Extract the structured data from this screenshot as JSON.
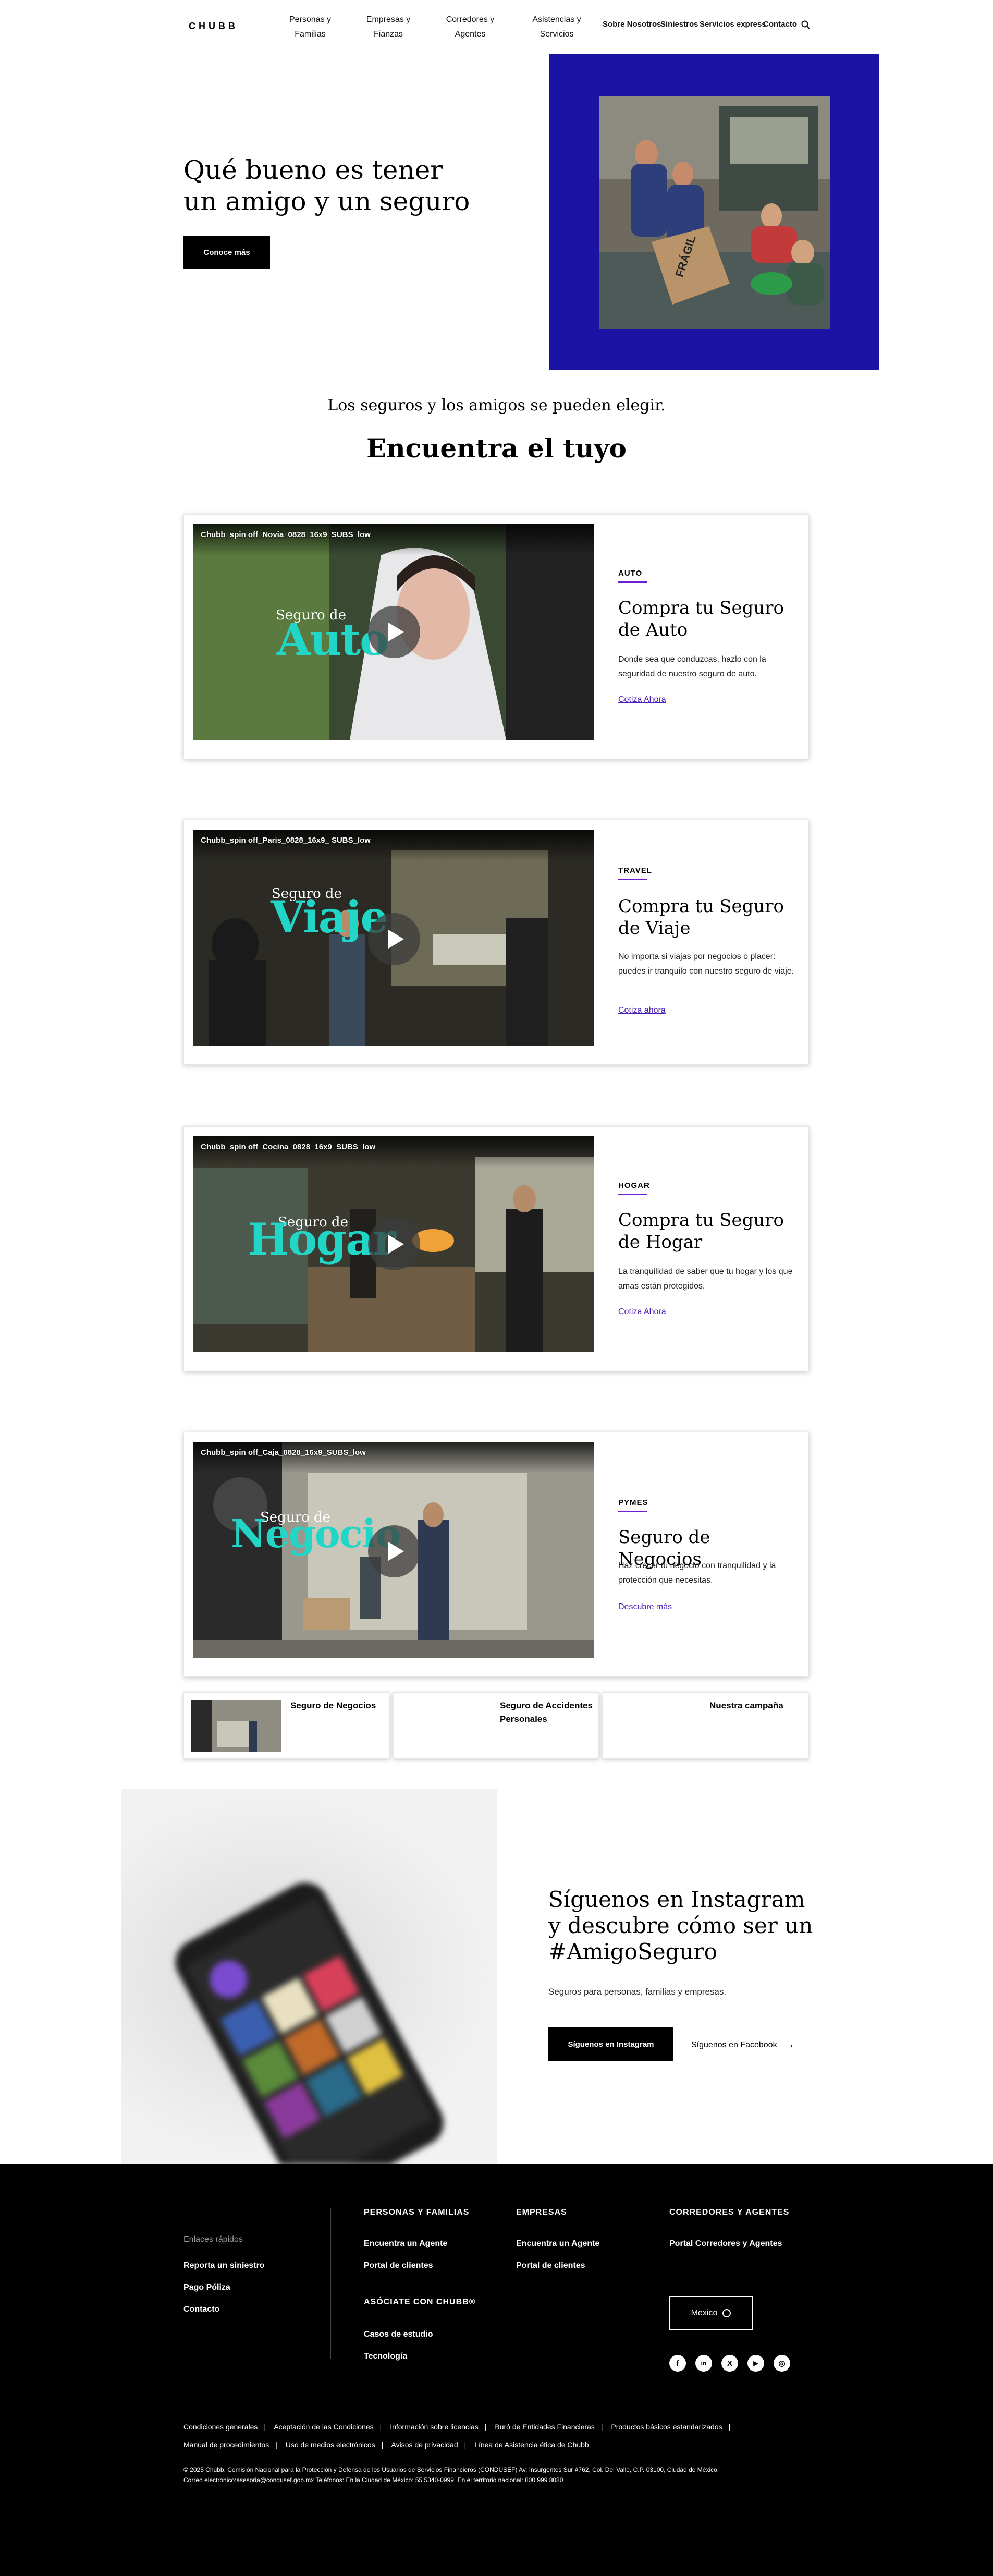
{
  "header": {
    "logo": "CHUBB",
    "nav": [
      "Personas y Familias",
      "Empresas y Fianzas",
      "Corredores y Agentes",
      "Asistencias y Servicios"
    ],
    "nav_right": [
      "Sobre Nosotros",
      "Siniestros",
      "Servicios express",
      "Contacto"
    ]
  },
  "hero": {
    "title": "Qué bueno es tener un amigo y un seguro",
    "cta": "Conoce más",
    "box_label": "FRÁGIL"
  },
  "intro": {
    "tagline": "Los seguros y los amigos se pueden elegir.",
    "title": "Encuentra el tuyo"
  },
  "cards": [
    {
      "video_title": "Chubb_spin off_Novia_0828_16x9_SUBS_low",
      "seguro": "Seguro de",
      "big": "Auto",
      "eyebrow": "AUTO",
      "title": "Compra tu Seguro de Auto",
      "desc": "Donde sea que conduzcas, hazlo con la seguridad de nuestro seguro de auto.",
      "link": "Cotiza Ahora"
    },
    {
      "video_title": "Chubb_spin off_Paris_0828_16x9_ SUBS_low",
      "seguro": "Seguro de",
      "big": "Viaje",
      "eyebrow": "TRAVEL",
      "title": "Compra tu Seguro de Viaje",
      "desc": "No importa si viajas por negocios o placer: puedes ir tranquilo con nuestro seguro de viaje.",
      "link": "Cotiza ahora"
    },
    {
      "video_title": "Chubb_spin off_Cocina_0828_16x9_SUBS_low",
      "seguro": "Seguro de",
      "big": "Hogar",
      "eyebrow": "HOGAR",
      "title": "Compra tu Seguro de Hogar",
      "desc": "La tranquilidad de saber que tu hogar y los que amas están protegidos.",
      "link": "Cotiza Ahora"
    },
    {
      "video_title": "Chubb_spin off_Caja_0828_16x9_SUBS_low",
      "seguro": "Seguro de",
      "big": "Negocio",
      "eyebrow": "PYMES",
      "title": "Seguro de Negocios",
      "desc": "Haz crecer tu negocio con tranquilidad y la protección que necesitas.",
      "link": "Descubre más"
    }
  ],
  "mini_cards": [
    "Seguro de Negocios",
    "Seguro de Accidentes Personales",
    "Nuestra campaña"
  ],
  "instagram": {
    "title": "Síguenos en Instagram y descubre cómo ser un #AmigoSeguro",
    "desc": "Seguros para personas, familias y empresas.",
    "btn_instagram": "Síguenos en Instagram",
    "btn_facebook": "Síguenos en Facebook"
  },
  "footer": {
    "quick_links_title": "Enlaces rápidos",
    "quick_links": [
      "Reporta un siniestro",
      "Pago Póliza",
      "Contacto"
    ],
    "col1_title": "PERSONAS Y FAMILIAS",
    "col1_links": [
      "Encuentra un Agente",
      "Portal de clientes"
    ],
    "col1b_title": "ASÓCIATE CON CHUBB®",
    "col1b_links": [
      "Casos de estudio",
      "Tecnología"
    ],
    "col2_title": "EMPRESAS",
    "col2_links": [
      "Encuentra un Agente",
      "Portal de clientes"
    ],
    "col3_title": "CORREDORES Y AGENTES",
    "col3_links": [
      "Portal Corredores y Agentes"
    ],
    "country": "Mexico",
    "social": [
      "f",
      "in",
      "X",
      "▶",
      "◎"
    ],
    "legal_row1": [
      "Condiciones generales",
      "Aceptación de las Condiciones",
      "Información sobre licencias",
      "Buró de Entidades Financieras",
      "Productos básicos estandarizados"
    ],
    "legal_row2": [
      "Manual de procedimientos",
      "Uso de medios electrónicos",
      "Avisos de privacidad",
      "Línea de Asistencia ética de Chubb"
    ],
    "copyright": "© 2025 Chubb. Comisión Nacional para la Protección y Defensa de los Usuarios de Servicios Financieros (CONDUSEF) Av. Insurgentes Sur #762, Col. Del Valle, C.P. 03100, Ciudad de México. Correo electrónico:asesoria@condusef.gob.mx Teléfonos: En la Ciudad de México: 55 5340-0999. En el territorio nacional: 800 999 8080"
  },
  "colors": {
    "hero_blue": "#1a13a3",
    "accent_purple": "#6a1fd0",
    "video_text": "#21d6c7"
  }
}
